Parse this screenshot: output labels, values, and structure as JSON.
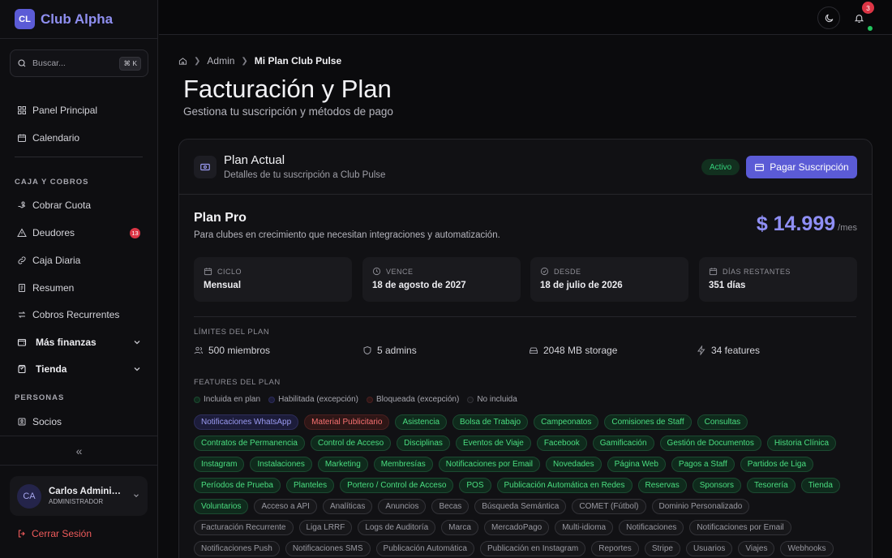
{
  "brand": {
    "logo": "CL",
    "name": "Club Alpha"
  },
  "search": {
    "placeholder": "Buscar...",
    "shortcut": "⌘ K"
  },
  "sidebar": {
    "main_items": [
      {
        "label": "Panel Principal",
        "icon": "grid-icon"
      },
      {
        "label": "Calendario",
        "icon": "calendar-icon"
      }
    ],
    "section_caja": "CAJA Y COBROS",
    "caja_items": [
      {
        "label": "Cobrar Cuota",
        "icon": "hand-coins-icon"
      },
      {
        "label": "Deudores",
        "icon": "alert-triangle-icon",
        "badge": "13"
      },
      {
        "label": "Caja Diaria",
        "icon": "link-icon"
      },
      {
        "label": "Resumen",
        "icon": "receipt-icon"
      },
      {
        "label": "Cobros Recurrentes",
        "icon": "refresh-icon"
      }
    ],
    "groups": [
      {
        "label": "Más finanzas",
        "icon": "wallet-icon"
      },
      {
        "label": "Tienda",
        "icon": "shopping-bag-icon"
      }
    ],
    "section_personas": "PERSONAS",
    "personas_items": [
      {
        "label": "Socios",
        "icon": "id-card-icon"
      }
    ],
    "collapse_label": "«"
  },
  "user": {
    "initials": "CA",
    "name": "Carlos Administrador",
    "role": "ADMINISTRADOR"
  },
  "logout_label": "Cerrar Sesión",
  "topbar": {
    "notifications_count": "3"
  },
  "breadcrumb": {
    "items": [
      "Admin"
    ],
    "current": "Mi Plan Club Pulse"
  },
  "page": {
    "title": "Facturación y Plan",
    "subtitle": "Gestiona tu suscripción y métodos de pago"
  },
  "plan_card": {
    "title": "Plan Actual",
    "subtitle": "Detalles de tu suscripción a Club Pulse",
    "status": "Activo",
    "pay_button": "Pagar Suscripción",
    "plan_name": "Plan Pro",
    "plan_desc": "Para clubes en crecimiento que necesitan integraciones y automatización.",
    "price": "$ 14.999",
    "price_period": "/mes",
    "stats": [
      {
        "label": "CICLO",
        "value": "Mensual",
        "icon": "calendar-icon"
      },
      {
        "label": "VENCE",
        "value": "18 de agosto de 2027",
        "icon": "clock-icon"
      },
      {
        "label": "DESDE",
        "value": "18 de julio de 2026",
        "icon": "check-circle-icon"
      },
      {
        "label": "DÍAS RESTANTES",
        "value": "351 días",
        "icon": "calendar-icon"
      }
    ],
    "limits_title": "LÍMITES DEL PLAN",
    "limits": [
      {
        "label": "500 miembros",
        "icon": "users-icon"
      },
      {
        "label": "5 admins",
        "icon": "shield-icon"
      },
      {
        "label": "2048 MB storage",
        "icon": "hard-drive-icon"
      },
      {
        "label": "34 features",
        "icon": "zap-icon"
      }
    ],
    "features_title": "FEATURES DEL PLAN",
    "legend": [
      {
        "label": "Incluida en plan",
        "kind": "incl"
      },
      {
        "label": "Habilitada (excepción)",
        "kind": "hab"
      },
      {
        "label": "Bloqueada (excepción)",
        "kind": "bloq"
      },
      {
        "label": "No incluida",
        "kind": "no"
      }
    ],
    "features": [
      {
        "label": "Notificaciones WhatsApp",
        "kind": "hab"
      },
      {
        "label": "Material Publicitario",
        "kind": "bloq"
      },
      {
        "label": "Asistencia",
        "kind": "incl"
      },
      {
        "label": "Bolsa de Trabajo",
        "kind": "incl"
      },
      {
        "label": "Campeonatos",
        "kind": "incl"
      },
      {
        "label": "Comisiones de Staff",
        "kind": "incl"
      },
      {
        "label": "Consultas",
        "kind": "incl"
      },
      {
        "label": "Contratos de Permanencia",
        "kind": "incl"
      },
      {
        "label": "Control de Acceso",
        "kind": "incl"
      },
      {
        "label": "Disciplinas",
        "kind": "incl"
      },
      {
        "label": "Eventos de Viaje",
        "kind": "incl"
      },
      {
        "label": "Facebook",
        "kind": "incl"
      },
      {
        "label": "Gamificación",
        "kind": "incl"
      },
      {
        "label": "Gestión de Documentos",
        "kind": "incl"
      },
      {
        "label": "Historia Clínica",
        "kind": "incl"
      },
      {
        "label": "Instagram",
        "kind": "incl"
      },
      {
        "label": "Instalaciones",
        "kind": "incl"
      },
      {
        "label": "Marketing",
        "kind": "incl"
      },
      {
        "label": "Membresías",
        "kind": "incl"
      },
      {
        "label": "Notificaciones por Email",
        "kind": "incl"
      },
      {
        "label": "Novedades",
        "kind": "incl"
      },
      {
        "label": "Página Web",
        "kind": "incl"
      },
      {
        "label": "Pagos a Staff",
        "kind": "incl"
      },
      {
        "label": "Partidos de Liga",
        "kind": "incl"
      },
      {
        "label": "Períodos de Prueba",
        "kind": "incl"
      },
      {
        "label": "Planteles",
        "kind": "incl"
      },
      {
        "label": "Portero / Control de Acceso",
        "kind": "incl"
      },
      {
        "label": "POS",
        "kind": "incl"
      },
      {
        "label": "Publicación Automática en Redes",
        "kind": "incl"
      },
      {
        "label": "Reservas",
        "kind": "incl"
      },
      {
        "label": "Sponsors",
        "kind": "incl"
      },
      {
        "label": "Tesorería",
        "kind": "incl"
      },
      {
        "label": "Tienda",
        "kind": "incl"
      },
      {
        "label": "Voluntarios",
        "kind": "incl"
      },
      {
        "label": "Acceso a API",
        "kind": "no"
      },
      {
        "label": "Analíticas",
        "kind": "no"
      },
      {
        "label": "Anuncios",
        "kind": "no"
      },
      {
        "label": "Becas",
        "kind": "no"
      },
      {
        "label": "Búsqueda Semántica",
        "kind": "no"
      },
      {
        "label": "COMET (Fútbol)",
        "kind": "no"
      },
      {
        "label": "Dominio Personalizado",
        "kind": "no"
      },
      {
        "label": "Facturación Recurrente",
        "kind": "no"
      },
      {
        "label": "Liga LRRF",
        "kind": "no"
      },
      {
        "label": "Logs de Auditoría",
        "kind": "no"
      },
      {
        "label": "Marca",
        "kind": "no"
      },
      {
        "label": "MercadoPago",
        "kind": "no"
      },
      {
        "label": "Multi-idioma",
        "kind": "no"
      },
      {
        "label": "Notificaciones",
        "kind": "no"
      },
      {
        "label": "Notificaciones por Email",
        "kind": "no"
      },
      {
        "label": "Notificaciones Push",
        "kind": "no"
      },
      {
        "label": "Notificaciones SMS",
        "kind": "no"
      },
      {
        "label": "Publicación Automática",
        "kind": "no"
      },
      {
        "label": "Publicación en Instagram",
        "kind": "no"
      },
      {
        "label": "Reportes",
        "kind": "no"
      },
      {
        "label": "Stripe",
        "kind": "no"
      },
      {
        "label": "Usuarios",
        "kind": "no"
      },
      {
        "label": "Viajes",
        "kind": "no"
      },
      {
        "label": "Webhooks",
        "kind": "no"
      }
    ]
  },
  "colors": {
    "accent": "#5b5bd6",
    "included": "#4ade80",
    "enabled": "#9b9bf2",
    "blocked": "#f87171",
    "not_included": "#9a9aa2",
    "danger": "#dc3545"
  }
}
